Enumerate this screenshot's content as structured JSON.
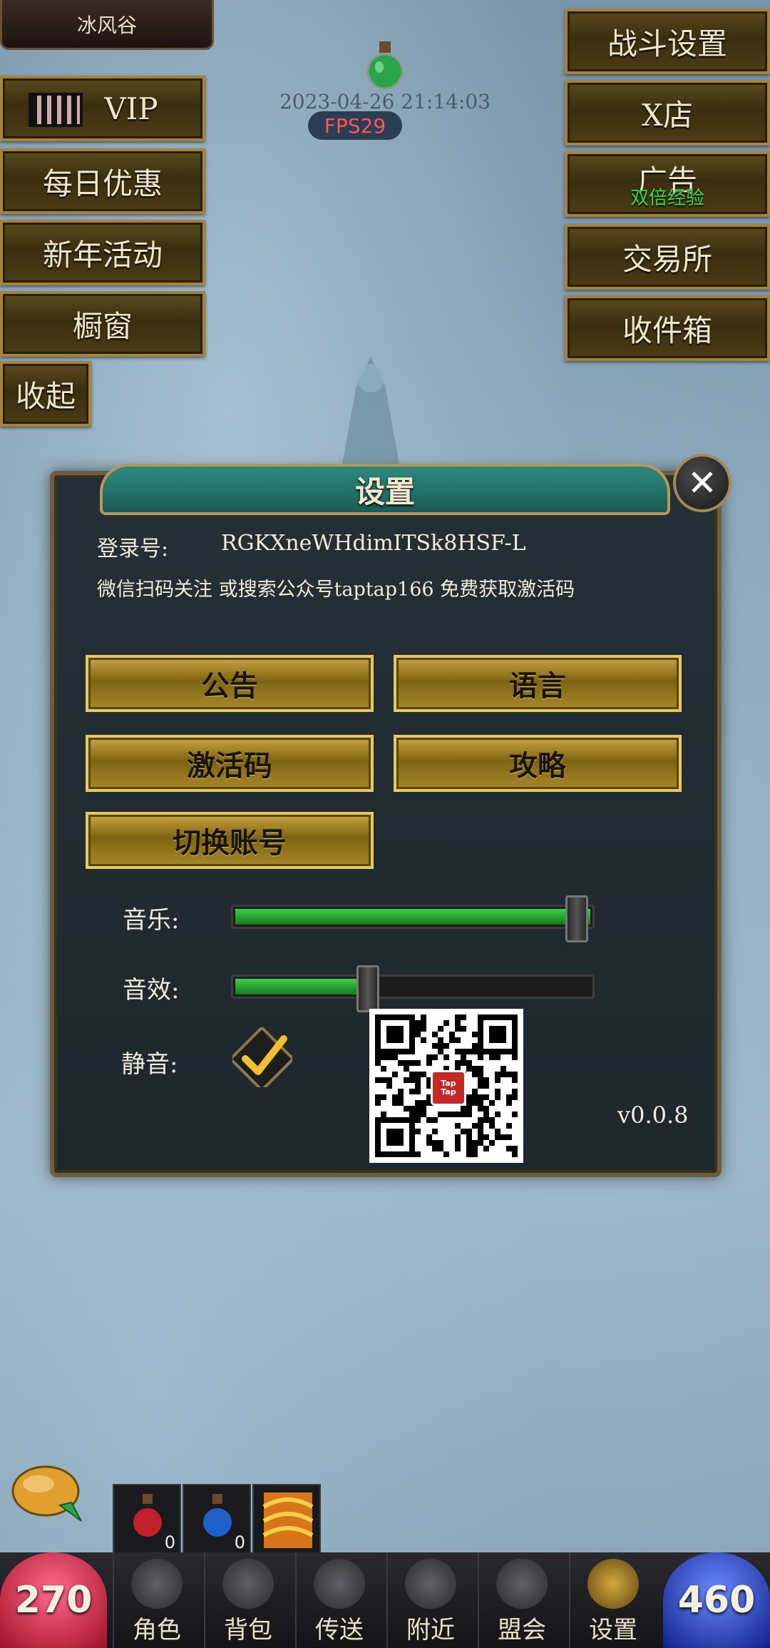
{
  "location": {
    "name": "冰风谷"
  },
  "left_menu": [
    {
      "id": "vip",
      "label": "VIP"
    },
    {
      "id": "daily",
      "label": "每日优惠"
    },
    {
      "id": "newyear",
      "label": "新年活动"
    },
    {
      "id": "showcase",
      "label": "橱窗"
    },
    {
      "id": "collapse",
      "label": "收起"
    }
  ],
  "right_menu": [
    {
      "id": "battle",
      "label": "战斗设置"
    },
    {
      "id": "xshop",
      "label": "X店"
    },
    {
      "id": "ad",
      "label": "广告",
      "sub": "双倍经验"
    },
    {
      "id": "exchange",
      "label": "交易所"
    },
    {
      "id": "mailbox",
      "label": "收件箱"
    }
  ],
  "status": {
    "datetime": "2023-04-26 21:14:03",
    "fps": "FPS29"
  },
  "settings": {
    "title": "设置",
    "close_icon": "✕",
    "login_label": "登录号:",
    "login_id": "RGKXneWHdimITSk8HSF-L",
    "wechat_note": "微信扫码关注 或搜索公众号taptap166 免费获取激活码",
    "buttons": {
      "announce": "公告",
      "language": "语言",
      "activation": "激活码",
      "guide": "攻略",
      "switch_account": "切换账号"
    },
    "music_label": "音乐:",
    "music_level": 1.0,
    "sfx_label": "音效:",
    "sfx_level": 0.38,
    "mute_label": "静音:",
    "mute_checked": true,
    "qr_badge": "Tap Tap",
    "version": "v0.0.8"
  },
  "quick_items": {
    "red_potion_count": "0",
    "blue_potion_count": "0"
  },
  "bottom": {
    "hp": "270",
    "mp": "460",
    "tabs": [
      "角色",
      "背包",
      "传送",
      "附近",
      "盟会",
      "设置"
    ]
  },
  "colors": {
    "accent_gold": "#e6c862",
    "slider_green": "#3fcf4a",
    "fps_red": "#ff5555",
    "teal_title": "#2e8a80"
  }
}
